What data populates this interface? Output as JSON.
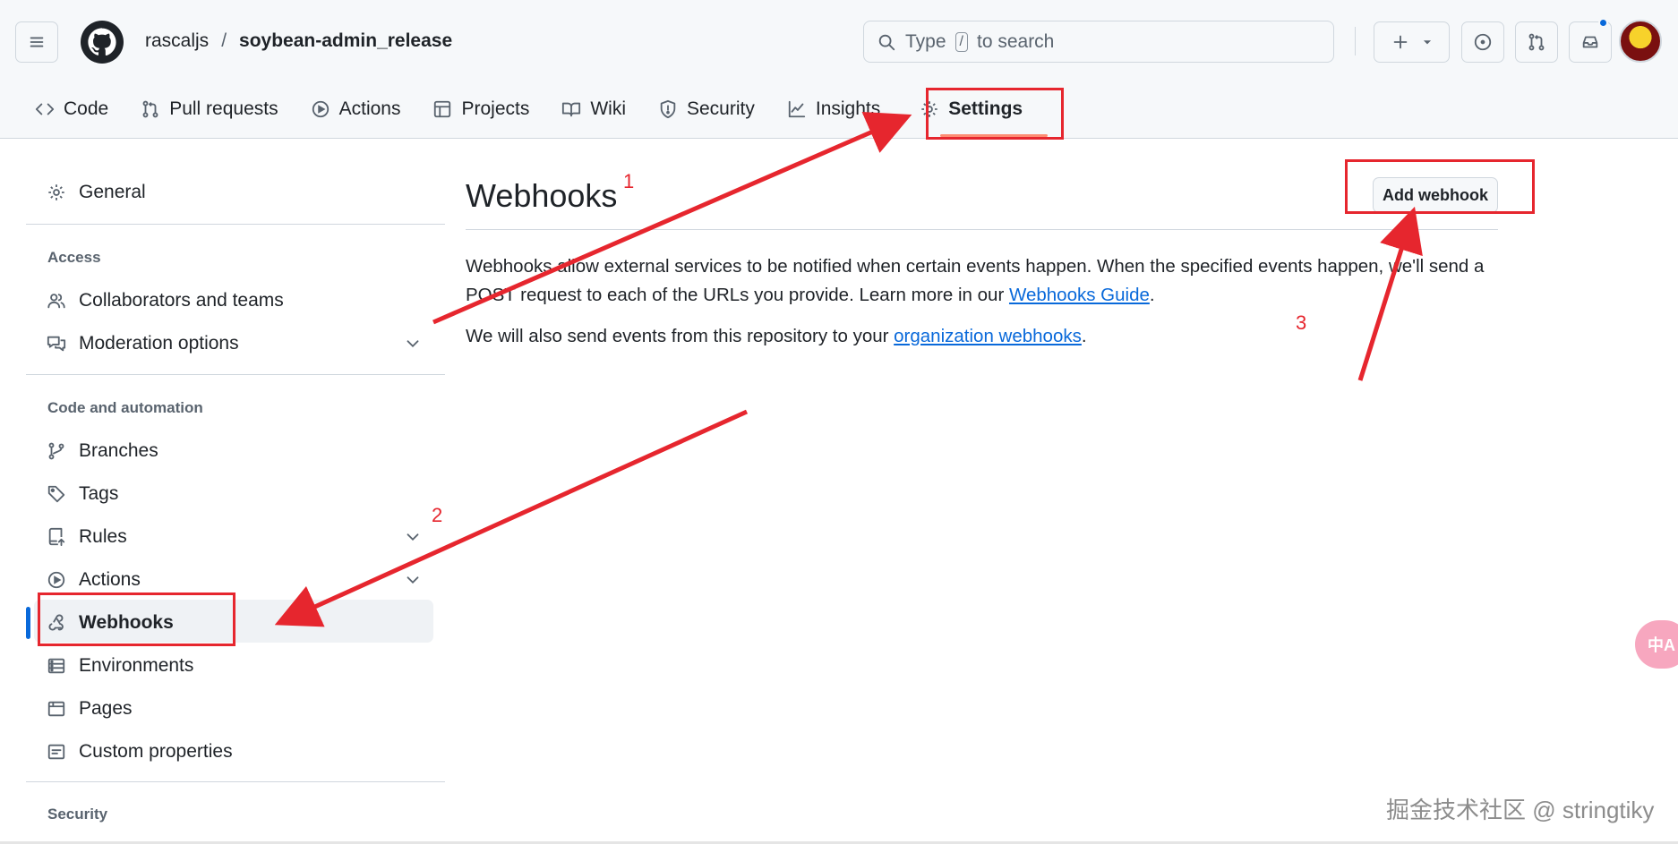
{
  "header": {
    "owner": "rascaljs",
    "separator": "/",
    "repo": "soybean-admin_release",
    "search_prefix": "Type",
    "search_key": "/",
    "search_suffix": "to search"
  },
  "tabs": [
    {
      "label": "Code",
      "icon": "code-icon"
    },
    {
      "label": "Pull requests",
      "icon": "pull-request-icon"
    },
    {
      "label": "Actions",
      "icon": "play-icon"
    },
    {
      "label": "Projects",
      "icon": "table-icon"
    },
    {
      "label": "Wiki",
      "icon": "book-icon"
    },
    {
      "label": "Security",
      "icon": "shield-icon"
    },
    {
      "label": "Insights",
      "icon": "graph-icon"
    },
    {
      "label": "Settings",
      "icon": "gear-icon",
      "active": true
    }
  ],
  "sidebar": {
    "general": "General",
    "access_heading": "Access",
    "collaborators": "Collaborators and teams",
    "moderation": "Moderation options",
    "code_heading": "Code and automation",
    "branches": "Branches",
    "tags": "Tags",
    "rules": "Rules",
    "actions": "Actions",
    "webhooks": "Webhooks",
    "environments": "Environments",
    "pages": "Pages",
    "custom_properties": "Custom properties",
    "security_heading": "Security"
  },
  "main": {
    "title": "Webhooks",
    "add_button": "Add webhook",
    "desc_part1": "Webhooks allow external services to be notified when certain events happen. When the specified events happen, we'll send a POST request to each of the URLs you provide. Learn more in our ",
    "desc_link": "Webhooks Guide",
    "desc_end": ".",
    "org_part1": "We will also send events from this repository to your ",
    "org_link": "organization webhooks",
    "org_end": "."
  },
  "annotations": {
    "step1": "1",
    "step2": "2",
    "step3": "3",
    "color": "#e6262e"
  },
  "watermark": "掘金技术社区 @ stringtiky",
  "translate_button": "中A",
  "colors": {
    "accent": "#0969da",
    "tab_underline": "#fd8c73",
    "annotation": "#e6262e"
  }
}
